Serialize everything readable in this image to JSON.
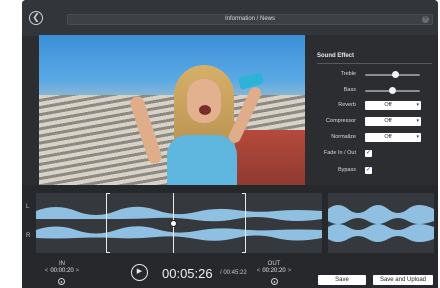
{
  "window": {
    "title": "Information / News"
  },
  "effects": {
    "title": "Sound Effect",
    "treble": {
      "label": "Treble",
      "value": 0.55
    },
    "bass": {
      "label": "Bass",
      "value": 0.5
    },
    "reverb": {
      "label": "Reverb",
      "value": "Off"
    },
    "compressor": {
      "label": "Compressor",
      "value": "Off"
    },
    "normalize": {
      "label": "Normalize",
      "value": "Off"
    },
    "fade": {
      "label": "Fade In / Out",
      "checked": true
    },
    "bypass": {
      "label": "Bypass",
      "checked": true
    }
  },
  "audio": {
    "channel_left": "L",
    "channel_right": "R",
    "in": {
      "label": "IN",
      "time": "00:00:20"
    },
    "out": {
      "label": "OUT",
      "time": "00:20:20"
    },
    "current_time": "00:05:26",
    "total_time": "/ 00:45:22"
  },
  "buttons": {
    "save": "Save",
    "save_upload": "Save and Upload"
  },
  "colors": {
    "waveform": "#9fd8ff",
    "panel_bg": "#2b2d31"
  }
}
